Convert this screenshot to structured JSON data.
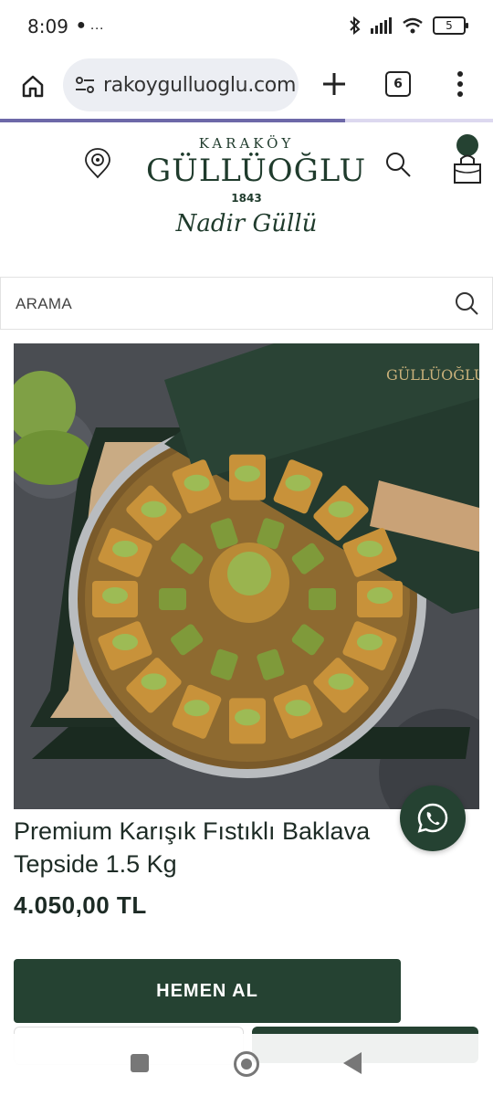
{
  "status_bar": {
    "time": "8:09",
    "notif_icons": "● …",
    "battery": "5"
  },
  "browser": {
    "url": "rakoygulluoglu.com",
    "tab_count": "6",
    "load_progress": 0.7
  },
  "header": {
    "logo": {
      "top": "KARAKÖY",
      "main": "GÜLLÜOĞLU",
      "year": "1843",
      "signature": "Nadir Güllü"
    }
  },
  "search": {
    "placeholder": "ARAMA"
  },
  "product": {
    "title": "Premium Karışık Fıstıklı Baklava\nTepside 1.5 Kg",
    "price": "4.050,00 TL",
    "buy_label": "HEMEN AL"
  },
  "colors": {
    "brand_green": "#254232",
    "progress": "#6d68a8"
  },
  "icons": [
    "home-icon",
    "site-settings-icon",
    "new-tab-icon",
    "tabs-icon",
    "menu-icon",
    "location-pin-icon",
    "search-icon",
    "cart-icon",
    "whatsapp-icon"
  ]
}
